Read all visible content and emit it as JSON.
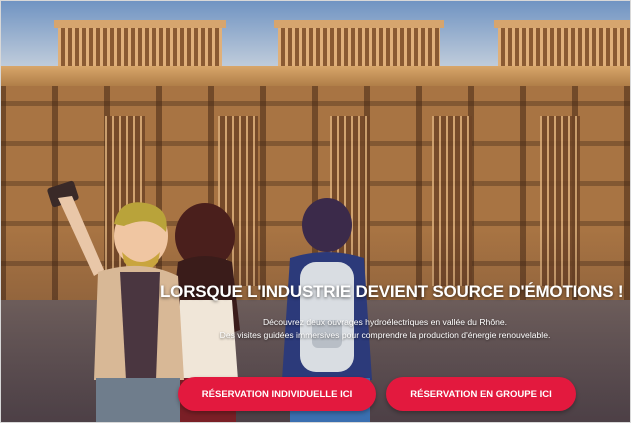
{
  "hero": {
    "headline": "LORSQUE L'INDUSTRIE DEVIENT SOURCE D'ÉMOTIONS !",
    "subline_1": "Découvrez deux ouvrages hydroélectriques en vallée du Rhône.",
    "subline_2": "Des visites guidées immersives pour comprendre la production d'énergie renouvelable."
  },
  "buttons": {
    "individual_label": "RÉSERVATION INDIVIDUELLE ICI",
    "group_label": "RÉSERVATION EN GROUPE ICI"
  },
  "colors": {
    "button": "#e3193e",
    "facade": "#b07b44",
    "sky": "#8fa9c8"
  }
}
